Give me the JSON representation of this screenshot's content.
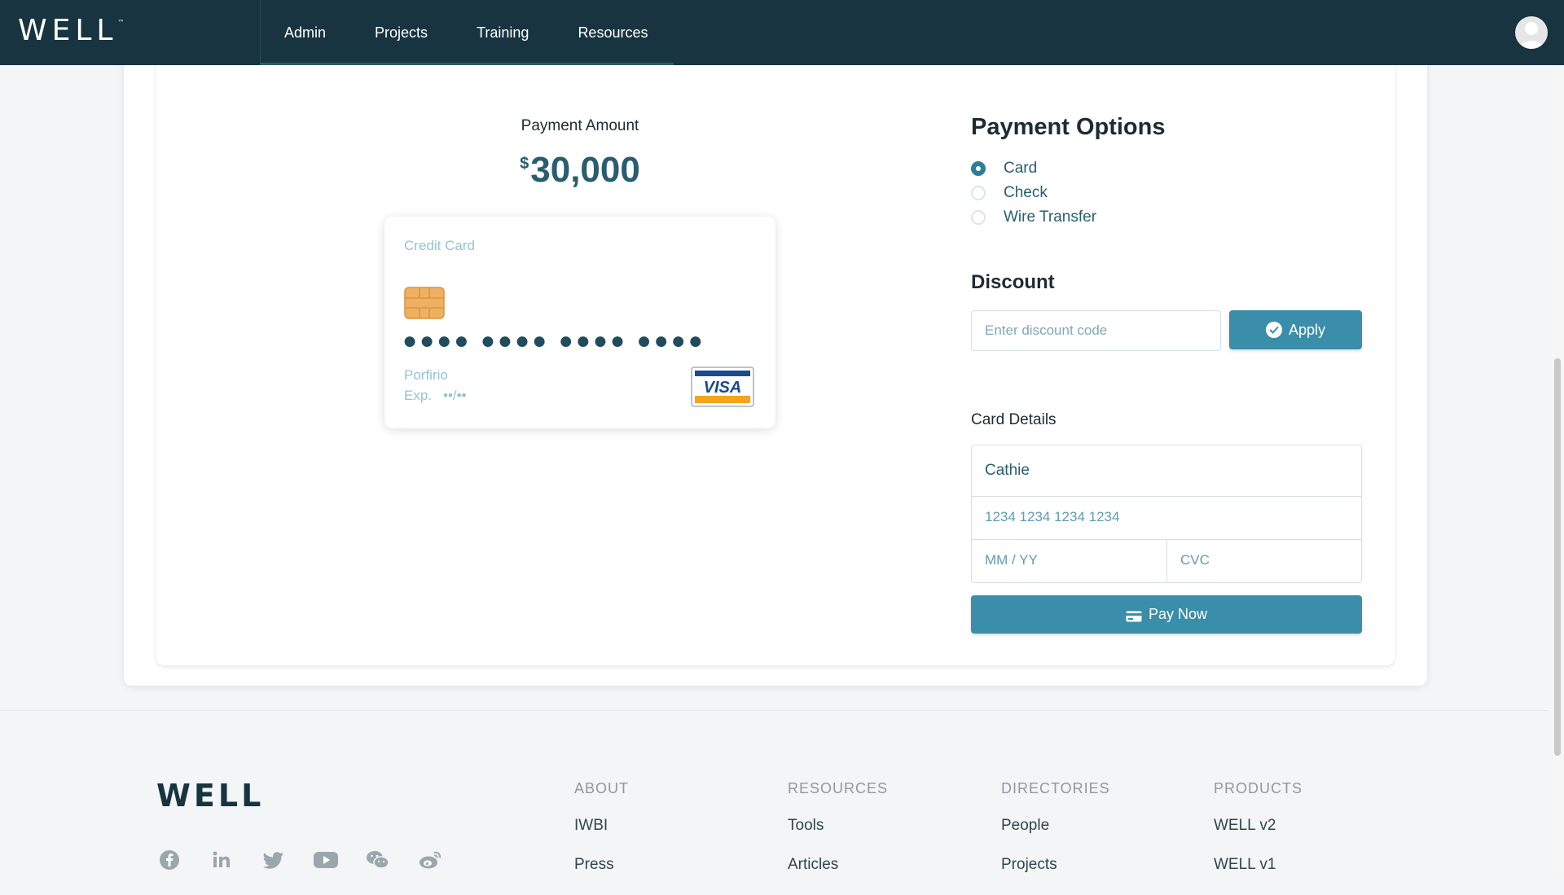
{
  "header": {
    "brand": "WELL",
    "brand_tm": "™",
    "nav": [
      "Admin",
      "Projects",
      "Training",
      "Resources"
    ]
  },
  "payment": {
    "amount_label": "Payment Amount",
    "currency": "$",
    "amount": "30,000"
  },
  "credit_card": {
    "title": "Credit Card",
    "number_mask": "●●●● ●●●● ●●●● ●●●●",
    "holder": "Porfirio",
    "exp_label": "Exp.",
    "exp_mask": "••/••",
    "brand": "VISA"
  },
  "options": {
    "heading": "Payment Options",
    "items": [
      {
        "label": "Card",
        "selected": true
      },
      {
        "label": "Check",
        "selected": false
      },
      {
        "label": "Wire Transfer",
        "selected": false
      }
    ]
  },
  "discount": {
    "heading": "Discount",
    "placeholder": "Enter discount code",
    "apply_label": "Apply"
  },
  "card_details": {
    "heading": "Card Details",
    "name_value": "Cathie",
    "number_placeholder": "1234 1234 1234 1234",
    "exp_placeholder": "MM / YY",
    "cvc_placeholder": "CVC",
    "pay_label": "Pay Now"
  },
  "footer": {
    "logo": "WELL",
    "social": [
      "facebook-icon",
      "linkedin-icon",
      "twitter-icon",
      "youtube-icon",
      "wechat-icon",
      "weibo-icon"
    ],
    "columns": [
      {
        "heading": "ABOUT",
        "links": [
          "IWBI",
          "Press"
        ]
      },
      {
        "heading": "RESOURCES",
        "links": [
          "Tools",
          "Articles"
        ]
      },
      {
        "heading": "DIRECTORIES",
        "links": [
          "People",
          "Projects"
        ]
      },
      {
        "heading": "PRODUCTS",
        "links": [
          "WELL v2",
          "WELL v1"
        ]
      }
    ]
  },
  "colors": {
    "nav_bg": "#173440",
    "accent": "#3a8ea9",
    "amount": "#2a5d70"
  }
}
